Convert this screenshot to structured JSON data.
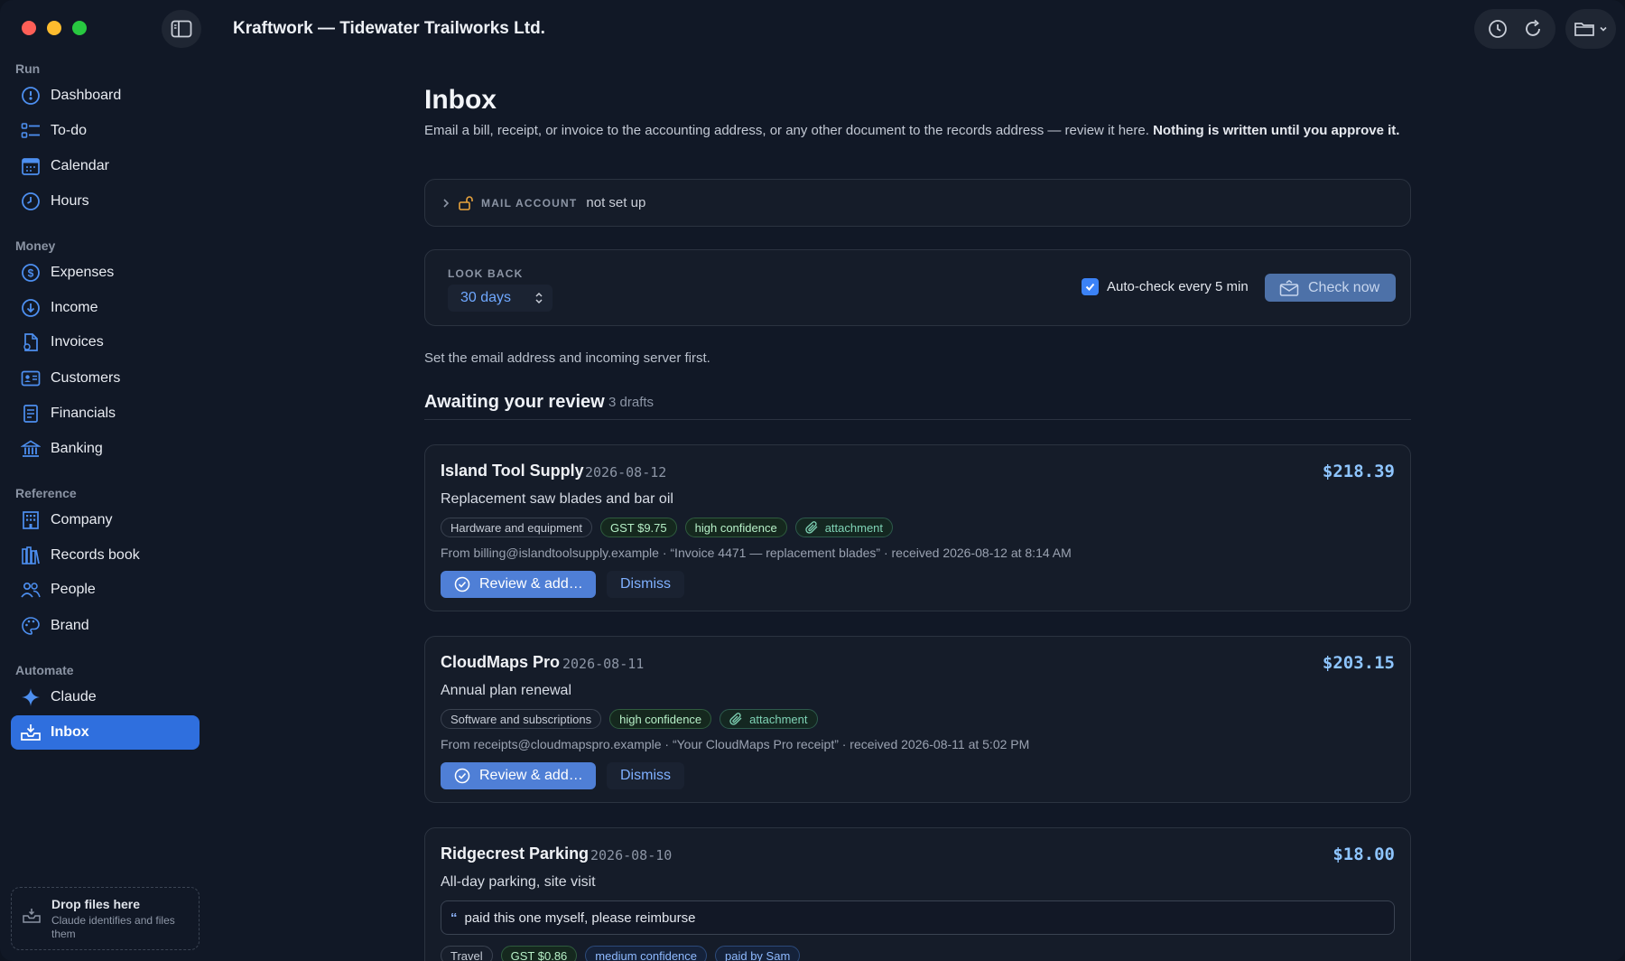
{
  "app": {
    "title": "Kraftwork — Tidewater Trailworks Ltd."
  },
  "sidebar": {
    "sections": [
      {
        "label": "Run"
      },
      {
        "label": "Money"
      },
      {
        "label": "Reference"
      },
      {
        "label": "Automate"
      }
    ],
    "items": [
      {
        "label": "Dashboard",
        "icon": "gauge-icon"
      },
      {
        "label": "To-do",
        "icon": "checklist-icon"
      },
      {
        "label": "Calendar",
        "icon": "calendar-icon"
      },
      {
        "label": "Hours",
        "icon": "clock-icon"
      },
      {
        "label": "Expenses",
        "icon": "dollar-icon"
      },
      {
        "label": "Income",
        "icon": "arrow-down-circle-icon"
      },
      {
        "label": "Invoices",
        "icon": "document-icon"
      },
      {
        "label": "Customers",
        "icon": "contact-card-icon"
      },
      {
        "label": "Financials",
        "icon": "report-icon"
      },
      {
        "label": "Banking",
        "icon": "bank-icon"
      },
      {
        "label": "Company",
        "icon": "building-icon"
      },
      {
        "label": "Records book",
        "icon": "books-icon"
      },
      {
        "label": "People",
        "icon": "people-icon"
      },
      {
        "label": "Brand",
        "icon": "palette-icon"
      },
      {
        "label": "Claude",
        "icon": "sparkle-icon"
      },
      {
        "label": "Inbox",
        "icon": "inbox-icon",
        "active": true
      }
    ],
    "drop_zone": {
      "title": "Drop files here",
      "subtitle": "Claude identifies and files them"
    }
  },
  "main": {
    "title": "Inbox",
    "subtitle": "Email a bill, receipt, or invoice to the accounting address, or any other document to the records address — review it here.",
    "subtitle_bold": "Nothing is written until you approve it.",
    "mail_account": {
      "label": "MAIL ACCOUNT",
      "status": "not set up"
    },
    "look_back": {
      "label": "LOOK BACK",
      "value": "30 days"
    },
    "auto_check": {
      "label": "Auto-check every 5 min",
      "checked": true
    },
    "check_now_label": "Check now",
    "setup_note": "Set the email address and incoming server first.",
    "awaiting": {
      "title": "Awaiting your review",
      "count": "3 drafts"
    },
    "drafts": [
      {
        "vendor": "Island Tool Supply",
        "date": "2026-08-12",
        "amount": "$218.39",
        "description": "Replacement saw blades and bar oil",
        "tags": [
          {
            "text": "Hardware and equipment",
            "kind": "category"
          },
          {
            "text": "GST $9.75",
            "kind": "gst"
          },
          {
            "text": "high confidence",
            "kind": "conf"
          },
          {
            "text": "attachment",
            "kind": "attach"
          }
        ],
        "meta": "From billing@islandtoolsupply.example · “Invoice 4471 — replacement blades” · received 2026-08-12 at 8:14 AM",
        "review_label": "Review & add…",
        "dismiss_label": "Dismiss"
      },
      {
        "vendor": "CloudMaps Pro",
        "date": "2026-08-11",
        "amount": "$203.15",
        "description": "Annual plan renewal",
        "tags": [
          {
            "text": "Software and subscriptions",
            "kind": "category"
          },
          {
            "text": "high confidence",
            "kind": "conf"
          },
          {
            "text": "attachment",
            "kind": "attach"
          }
        ],
        "meta": "From receipts@cloudmapspro.example · “Your CloudMaps Pro receipt” · received 2026-08-11 at 5:02 PM",
        "review_label": "Review & add…",
        "dismiss_label": "Dismiss"
      },
      {
        "vendor": "Ridgecrest Parking",
        "date": "2026-08-10",
        "amount": "$18.00",
        "description": "All-day parking, site visit",
        "note": "paid this one myself, please reimburse",
        "tags": [
          {
            "text": "Travel",
            "kind": "category"
          },
          {
            "text": "GST $0.86",
            "kind": "gst"
          },
          {
            "text": "medium confidence",
            "kind": "medconf"
          },
          {
            "text": "paid by Sam",
            "kind": "paid"
          }
        ]
      }
    ]
  },
  "colors": {
    "accent": "#2f6fde",
    "amount": "#8ec5ff",
    "background": "#111826"
  }
}
